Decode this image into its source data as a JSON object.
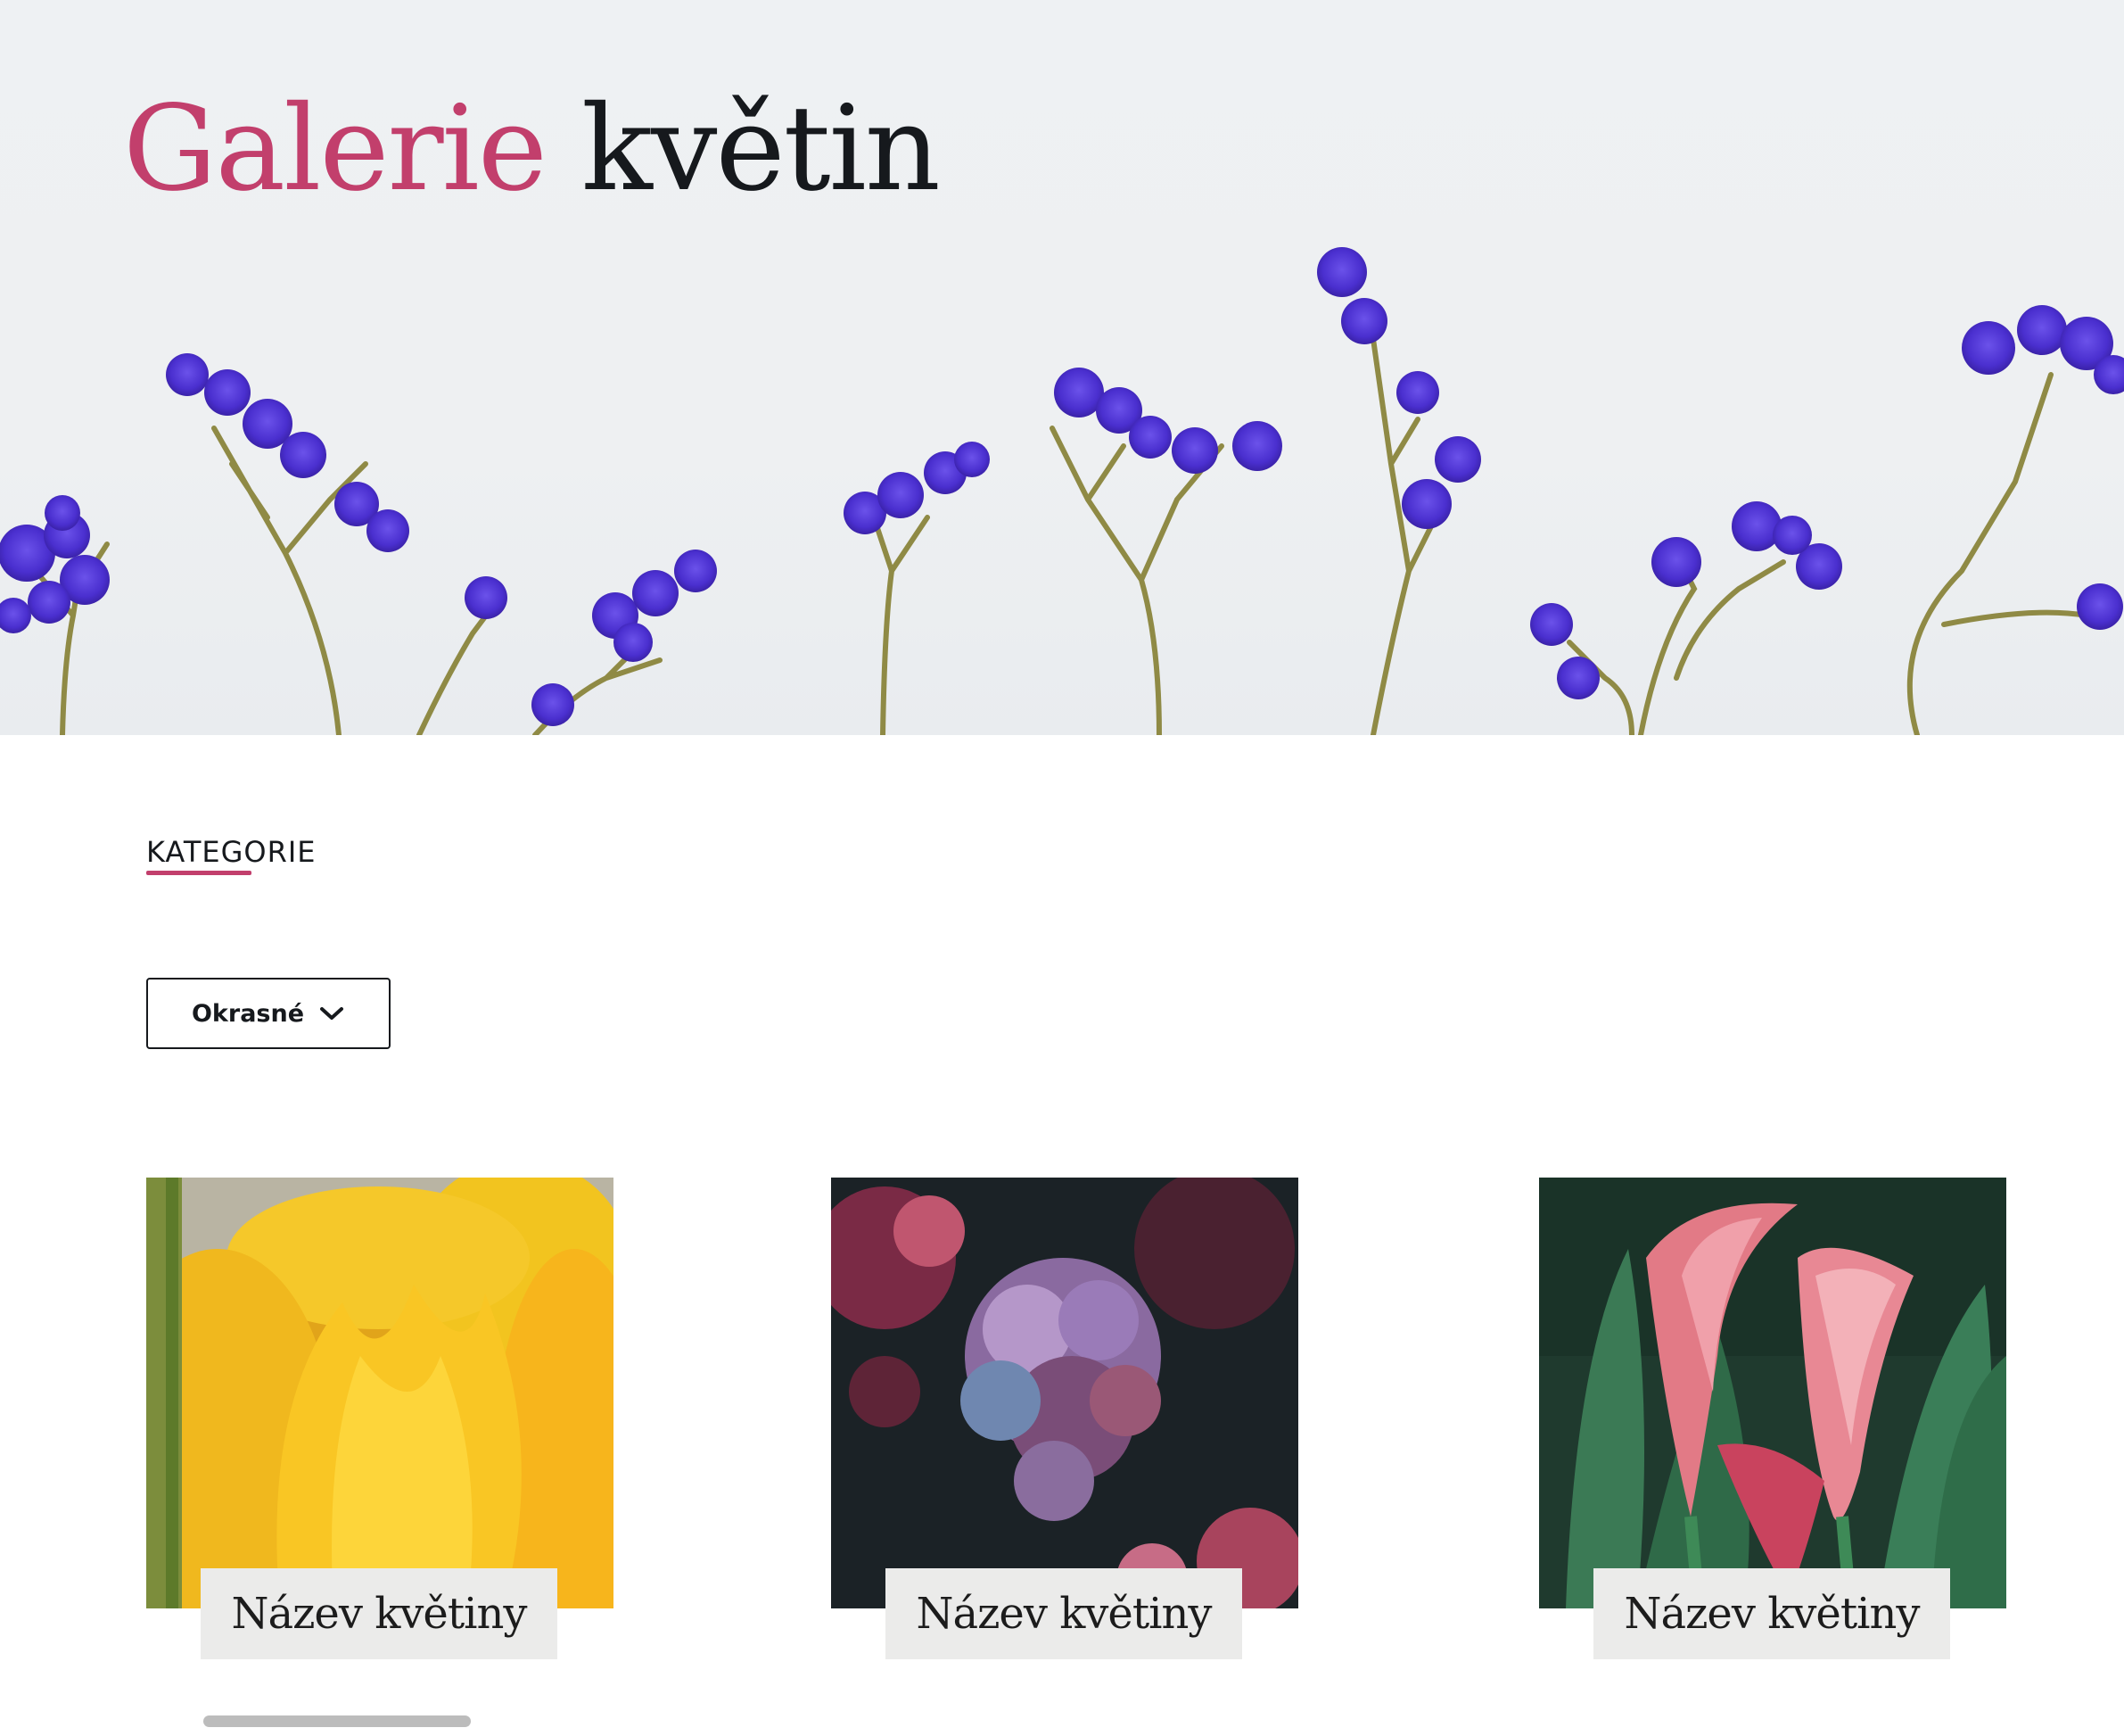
{
  "hero": {
    "title_part1": "Galerie",
    "title_part2": "květin",
    "accent_color": "#c23f6c",
    "image": "purple statice flowers on light background"
  },
  "categories": {
    "label": "KATEGORIE",
    "selected": "Okrasné",
    "dropdown_icon": "chevron-down-icon"
  },
  "gallery": {
    "cards": [
      {
        "caption": "Název květiny",
        "image": "yellow tulip"
      },
      {
        "caption": "Název květiny",
        "image": "purple pink hydrangea"
      },
      {
        "caption": "Název květiny",
        "image": "pink calla lily"
      }
    ]
  },
  "colors": {
    "accent": "#c23f6c",
    "text": "#16191d",
    "caption_bg": "#ebebea",
    "hero_bg": "#eef1f3"
  }
}
